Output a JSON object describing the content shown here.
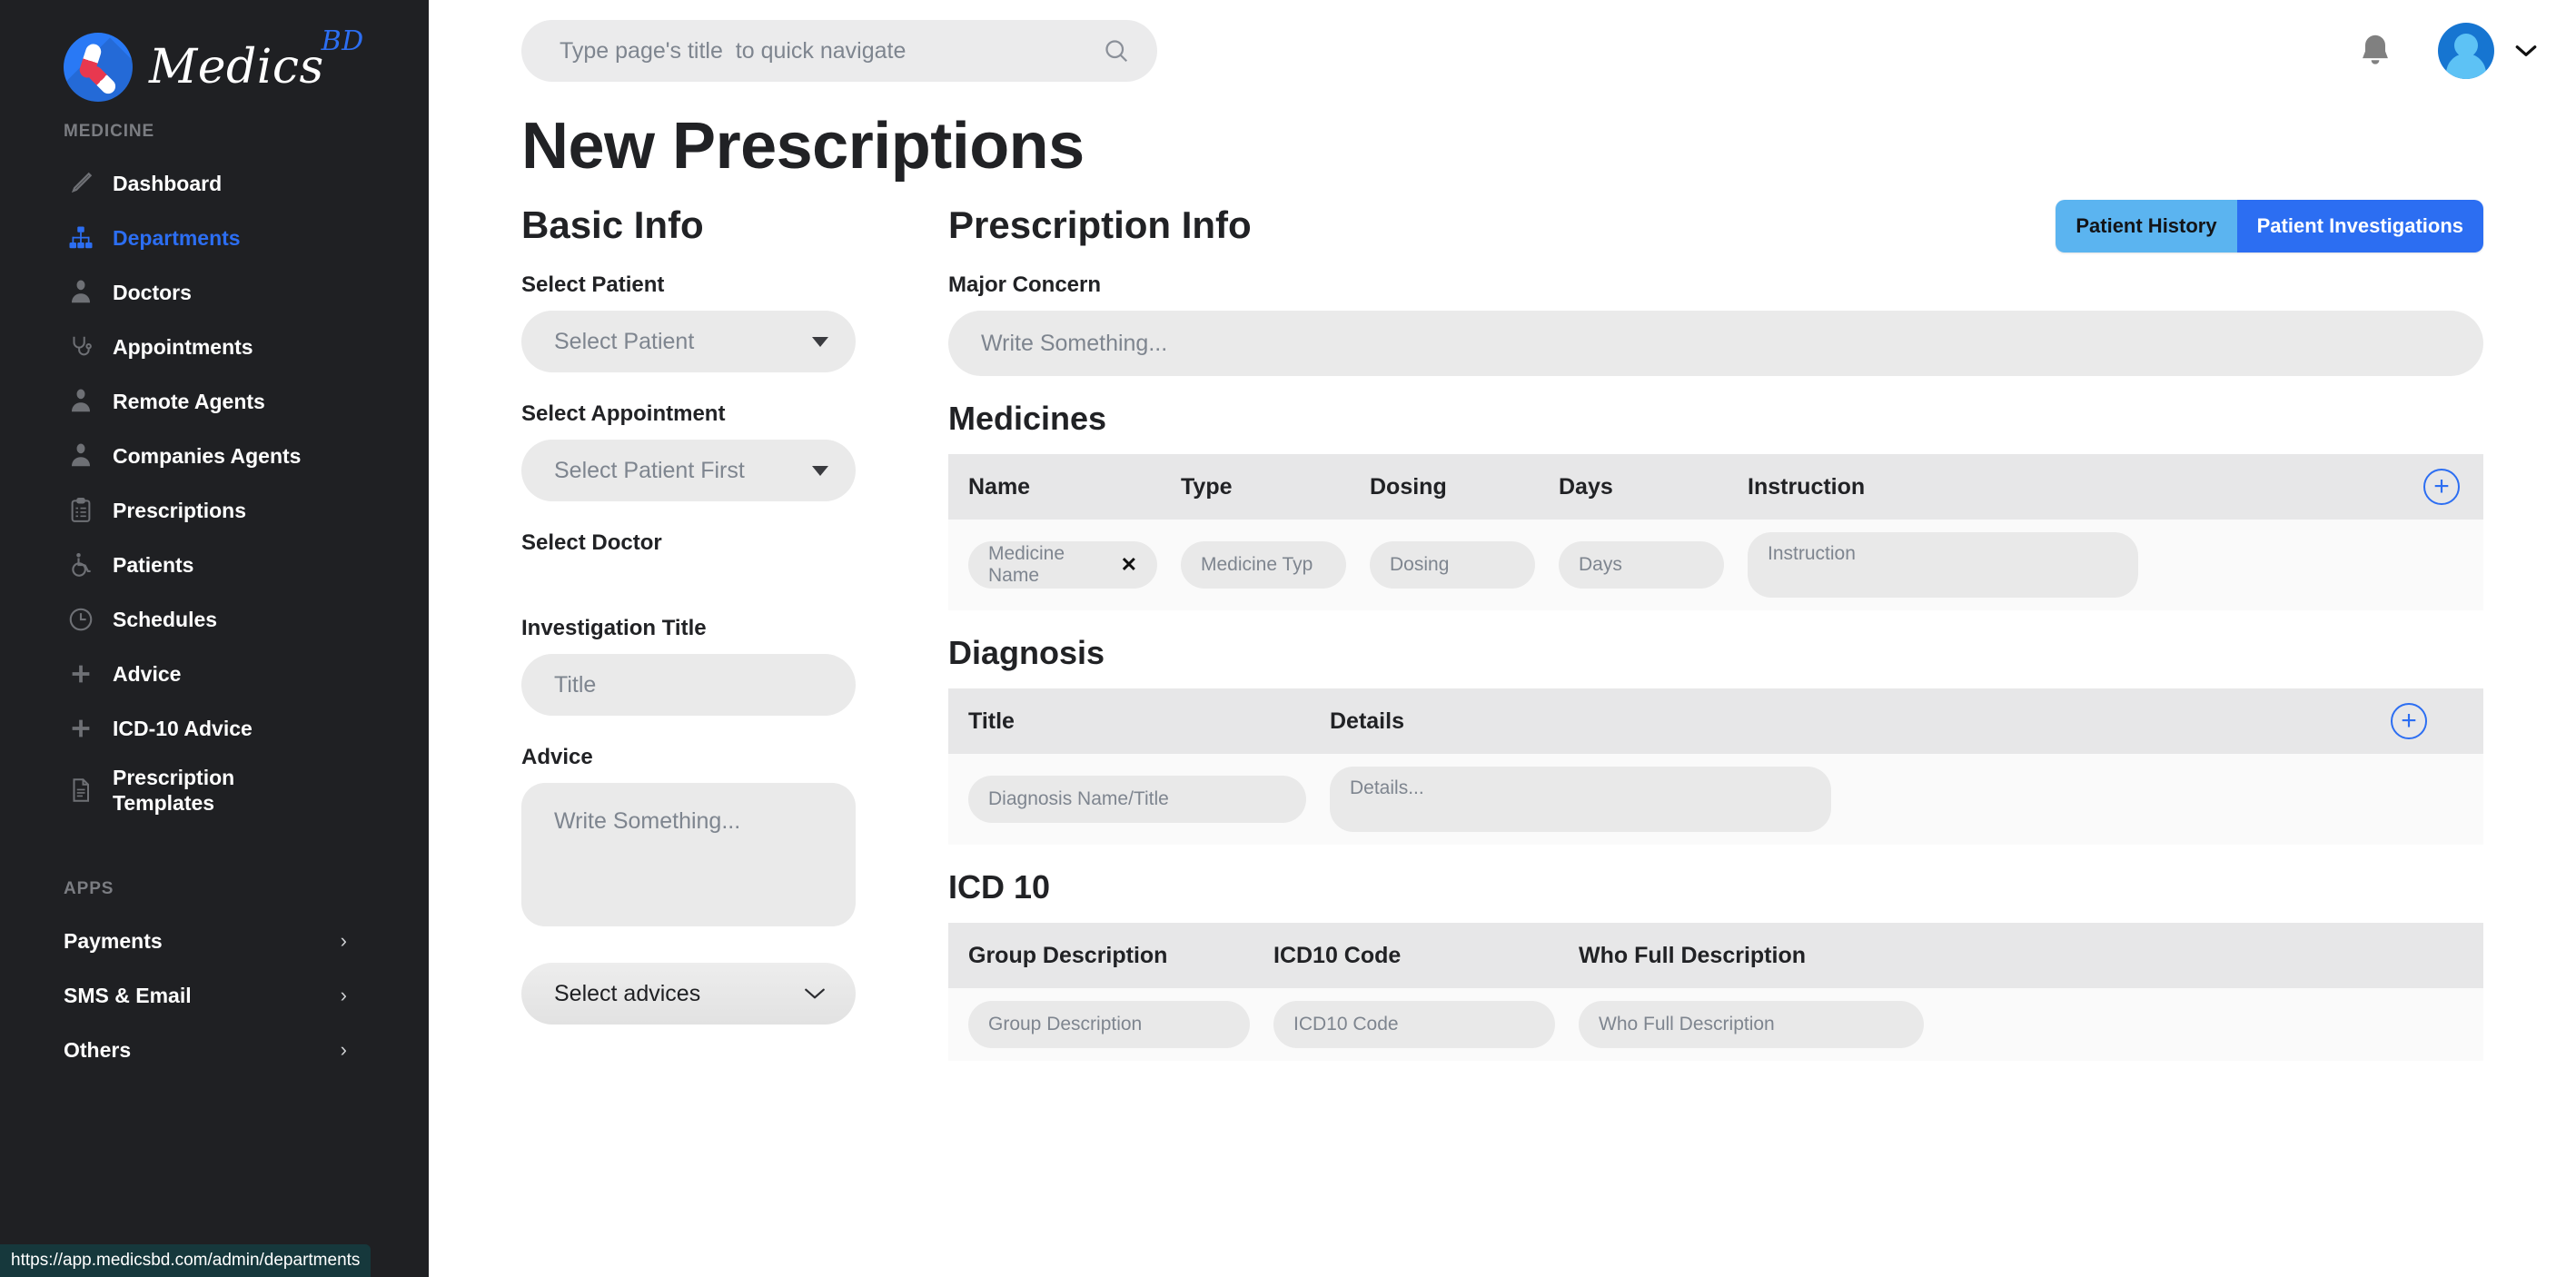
{
  "brand": {
    "name": "Medics",
    "superscript": "BD"
  },
  "sidebar": {
    "group_medicine_label": "MEDICINE",
    "group_apps_label": "APPS",
    "items": [
      {
        "label": "Dashboard",
        "icon": "thermometer-icon",
        "active": false
      },
      {
        "label": "Departments",
        "icon": "org-chart-icon",
        "active": true
      },
      {
        "label": "Doctors",
        "icon": "doctor-icon",
        "active": false
      },
      {
        "label": "Appointments",
        "icon": "stethoscope-icon",
        "active": false
      },
      {
        "label": "Remote Agents",
        "icon": "doctor-icon",
        "active": false
      },
      {
        "label": "Companies Agents",
        "icon": "doctor-icon",
        "active": false
      },
      {
        "label": "Prescriptions",
        "icon": "clipboard-icon",
        "active": false
      },
      {
        "label": "Patients",
        "icon": "wheelchair-icon",
        "active": false
      },
      {
        "label": "Schedules",
        "icon": "clock-icon",
        "active": false
      },
      {
        "label": "Advice",
        "icon": "plus-icon",
        "active": false
      },
      {
        "label": "ICD-10 Advice",
        "icon": "plus-icon",
        "active": false
      },
      {
        "label": "Prescription Templates",
        "icon": "document-icon",
        "active": false
      }
    ],
    "apps": [
      {
        "label": "Payments",
        "chevron": "›"
      },
      {
        "label": "SMS & Email",
        "chevron": "›"
      },
      {
        "label": "Others",
        "chevron": "›"
      }
    ]
  },
  "status_bar": {
    "url": "https://app.medicsbd.com/admin/departments"
  },
  "topbar": {
    "search_placeholder": "Type page's title  to quick navigate",
    "search_value": "",
    "search_icon": "search-icon",
    "bell_icon": "bell-icon",
    "avatar_icon": "user-avatar-icon",
    "caret": "⌄"
  },
  "page": {
    "title": "New Prescriptions"
  },
  "basic_info": {
    "heading": "Basic Info",
    "select_patient": {
      "label": "Select Patient",
      "value": "Select Patient"
    },
    "select_appointment": {
      "label": "Select Appointment",
      "value": "Select Patient First"
    },
    "select_doctor": {
      "label": "Select Doctor"
    },
    "investigation_title": {
      "label": "Investigation Title",
      "placeholder": "Title"
    },
    "advice": {
      "label": "Advice",
      "placeholder": "Write Something..."
    },
    "select_advices": {
      "value": "Select advices"
    }
  },
  "prescription_info": {
    "heading": "Prescription Info",
    "tabs": [
      {
        "label": "Patient History",
        "active": false
      },
      {
        "label": "Patient Investigations",
        "active": true
      }
    ],
    "major_concern": {
      "label": "Major Concern",
      "placeholder": "Write Something..."
    }
  },
  "medicines": {
    "heading": "Medicines",
    "add_label": "+",
    "columns": [
      "Name",
      "Type",
      "Dosing",
      "Days",
      "Instruction"
    ],
    "rows": [
      {
        "name": "Medicine Name",
        "name_clear": "✕",
        "type": "Medicine Typ",
        "dosing": "Dosing",
        "days": "Days",
        "instruction": "Instruction"
      }
    ]
  },
  "diagnosis": {
    "heading": "Diagnosis",
    "add_label": "+",
    "columns": [
      "Title",
      "Details"
    ],
    "rows": [
      {
        "title": "Diagnosis Name/Title",
        "details": "Details..."
      }
    ]
  },
  "icd10": {
    "heading": "ICD 10",
    "columns": [
      "Group Description",
      "ICD10 Code",
      "Who Full Description"
    ],
    "rows": [
      {
        "group": "Group Description",
        "code": "ICD10 Code",
        "who": "Who Full Description"
      }
    ]
  },
  "colors": {
    "sidebar_bg": "#1f2023",
    "accent_blue": "#2c6ef2",
    "tab_light_blue": "#5bb4f0",
    "field_gray": "#eaeaea",
    "status_bar_bg": "#16383c"
  }
}
